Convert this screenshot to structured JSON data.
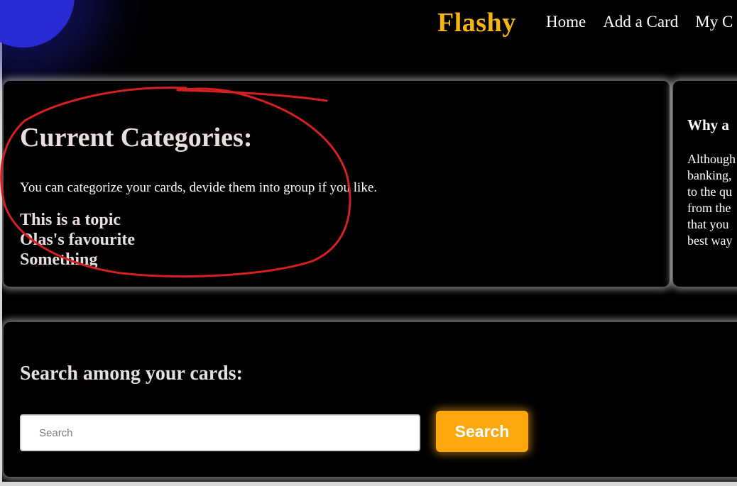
{
  "header": {
    "brand": "Flashy",
    "nav": [
      "Home",
      "Add a Card",
      "My C"
    ]
  },
  "categories": {
    "title": "Current Categories:",
    "description": "You can categorize your cards, devide them into group if you like.",
    "topics": [
      "This is a topic",
      "Olas's favourite",
      "Something"
    ]
  },
  "why_card": {
    "title": "Why a",
    "lines": [
      "Although",
      "banking,",
      "to the qu",
      "from the",
      "that you",
      "best way"
    ]
  },
  "search": {
    "title": "Search among your cards:",
    "placeholder": "Search",
    "button_label": "Search"
  },
  "colors": {
    "brand": "#f5b412",
    "accent_button": "#fda70f",
    "annotation": "#d42020",
    "blob": "#2a2ad4"
  }
}
